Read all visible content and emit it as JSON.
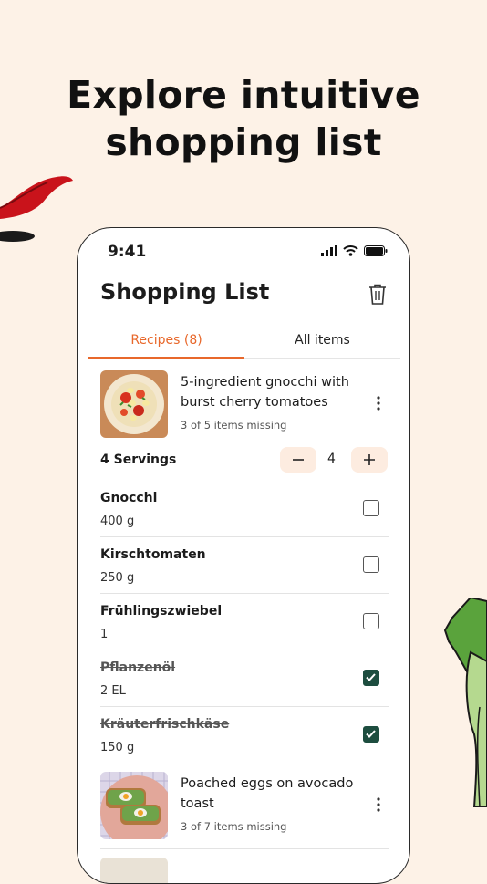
{
  "headline": {
    "line1": "Explore intuitive",
    "line2": "shopping list"
  },
  "status_bar": {
    "time": "9:41"
  },
  "page": {
    "title": "Shopping List"
  },
  "tabs": [
    {
      "label": "Recipes (8)",
      "active": true
    },
    {
      "label": "All items",
      "active": false
    }
  ],
  "recipes": [
    {
      "title": "5-ingredient gnocchi with burst cherry tomatoes",
      "status": "3 of 5 items missing"
    },
    {
      "title": "Poached eggs on avocado toast",
      "status": "3 of 7 items missing"
    }
  ],
  "servings": {
    "label": "4 Servings",
    "count": "4"
  },
  "items": [
    {
      "name": "Gnocchi",
      "qty": "400 g",
      "checked": false
    },
    {
      "name": "Kirschtomaten",
      "qty": "250 g",
      "checked": false
    },
    {
      "name": "Frühlingszwiebel",
      "qty": "1",
      "checked": false
    },
    {
      "name": "Pflanzenöl",
      "qty": "2 EL",
      "checked": true
    },
    {
      "name": "Kräuterfrischkäse",
      "qty": "150 g",
      "checked": true
    }
  ],
  "colors": {
    "accent": "#e8682b",
    "check": "#1d4d3f",
    "background": "#fdf2e7",
    "stepper": "#fdece0"
  },
  "icons": [
    "signal-icon",
    "wifi-icon",
    "battery-icon",
    "trash-icon",
    "more-vertical-icon",
    "minus-icon",
    "plus-icon",
    "checkmark-icon"
  ]
}
